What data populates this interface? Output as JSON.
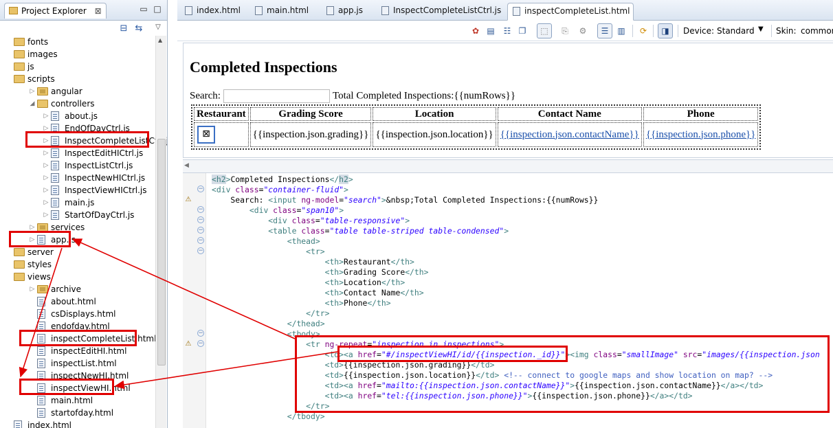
{
  "explorer": {
    "title": "Project Explorer",
    "close": "⊠",
    "items": [
      {
        "label": "fonts",
        "indent": 0,
        "kind": "folder",
        "twisty": ""
      },
      {
        "label": "images",
        "indent": 0,
        "kind": "folder",
        "twisty": ""
      },
      {
        "label": "js",
        "indent": 0,
        "kind": "folder",
        "twisty": ""
      },
      {
        "label": "scripts",
        "indent": 0,
        "kind": "folder",
        "twisty": ""
      },
      {
        "label": "angular",
        "indent": 1,
        "kind": "folder-pkg",
        "twisty": "▷"
      },
      {
        "label": "controllers",
        "indent": 1,
        "kind": "folder",
        "twisty": "◢"
      },
      {
        "label": "about.js",
        "indent": 2,
        "kind": "file-js",
        "twisty": "▷"
      },
      {
        "label": "EndOfDayCtrl.js",
        "indent": 2,
        "kind": "file-js",
        "twisty": "▷"
      },
      {
        "label": "InspectCompleteListCtrl.js",
        "indent": 2,
        "kind": "file-js",
        "twisty": "▷"
      },
      {
        "label": "InspectEditHICtrl.js",
        "indent": 2,
        "kind": "file-js",
        "twisty": "▷"
      },
      {
        "label": "InspectListCtrl.js",
        "indent": 2,
        "kind": "file-js",
        "twisty": "▷"
      },
      {
        "label": "InspectNewHICtrl.js",
        "indent": 2,
        "kind": "file-js",
        "twisty": "▷"
      },
      {
        "label": "InspectViewHICtrl.js",
        "indent": 2,
        "kind": "file-js",
        "twisty": "▷"
      },
      {
        "label": "main.js",
        "indent": 2,
        "kind": "file-js",
        "twisty": "▷"
      },
      {
        "label": "StartOfDayCtrl.js",
        "indent": 2,
        "kind": "file-js",
        "twisty": "▷"
      },
      {
        "label": "services",
        "indent": 1,
        "kind": "folder-pkg",
        "twisty": "▷"
      },
      {
        "label": "app.js",
        "indent": 1,
        "kind": "file-js",
        "twisty": "▷"
      },
      {
        "label": "server",
        "indent": 0,
        "kind": "folder",
        "twisty": ""
      },
      {
        "label": "styles",
        "indent": 0,
        "kind": "folder",
        "twisty": ""
      },
      {
        "label": "views",
        "indent": 0,
        "kind": "folder",
        "twisty": ""
      },
      {
        "label": "archive",
        "indent": 1,
        "kind": "folder-pkg",
        "twisty": "▷"
      },
      {
        "label": "about.html",
        "indent": 1,
        "kind": "file",
        "twisty": ""
      },
      {
        "label": "csDisplays.html",
        "indent": 1,
        "kind": "file",
        "twisty": ""
      },
      {
        "label": "endofday.html",
        "indent": 1,
        "kind": "file",
        "twisty": ""
      },
      {
        "label": "inspectCompleteList.html",
        "indent": 1,
        "kind": "file",
        "twisty": ""
      },
      {
        "label": "inspectEditHI.html",
        "indent": 1,
        "kind": "file",
        "twisty": ""
      },
      {
        "label": "inspectList.html",
        "indent": 1,
        "kind": "file",
        "twisty": ""
      },
      {
        "label": "inspectNewHI.html",
        "indent": 1,
        "kind": "file",
        "twisty": ""
      },
      {
        "label": "inspectViewHI.html",
        "indent": 1,
        "kind": "file",
        "twisty": ""
      },
      {
        "label": "main.html",
        "indent": 1,
        "kind": "file",
        "twisty": ""
      },
      {
        "label": "startofday.html",
        "indent": 1,
        "kind": "file",
        "twisty": ""
      },
      {
        "label": "index.html",
        "indent": 0,
        "kind": "file",
        "twisty": ""
      }
    ]
  },
  "editor": {
    "tabs": [
      {
        "label": "index.html",
        "active": false
      },
      {
        "label": "main.html",
        "active": false
      },
      {
        "label": "app.js",
        "active": false
      },
      {
        "label": "InspectCompleteListCtrl.js",
        "active": false
      },
      {
        "label": "inspectCompleteList.html",
        "active": true
      }
    ],
    "tab_close": "⊠",
    "toolbar": {
      "device_label": "Device:",
      "device_value": "Standard",
      "skin_label": "Skin:",
      "skin_value": "common"
    },
    "preview": {
      "heading": "Completed Inspections",
      "search_label": "Search:",
      "total_text": "Total Completed Inspections:{{numRows}}",
      "headers": [
        "Restaurant",
        "Grading Score",
        "Location",
        "Contact Name",
        "Phone"
      ],
      "cells": [
        "{{inspection.json.grading}}",
        "{{inspection.json.location}}",
        "{{inspection.json.contactName}}",
        "{{inspection.json.phone}}"
      ],
      "broken_image": "⊠"
    }
  },
  "colors": {
    "highlight": "#e00000",
    "link": "#1a4faa",
    "tag": "#3f7f7f",
    "attr": "#7f007f",
    "value": "#2a00ff"
  }
}
